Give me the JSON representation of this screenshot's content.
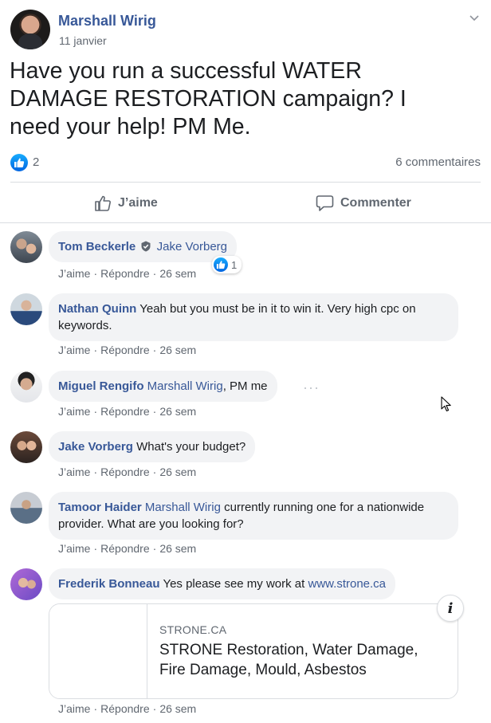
{
  "post": {
    "author": "Marshall Wirig",
    "date": "11 janvier",
    "text": "Have you run a successful WATER DAMAGE RESTORATION campaign? I need your help! PM Me.",
    "reaction_count": "2",
    "comments_count": "6 commentaires",
    "like_label": "J’aime",
    "comment_label": "Commenter"
  },
  "actions": {
    "like": "J’aime",
    "reply": "Répondre",
    "sep": "·"
  },
  "comments": [
    {
      "name": "Tom Beckerle",
      "verified": true,
      "mention": "Jake Vorberg",
      "text": "",
      "time": "26 sem",
      "reactions": "1"
    },
    {
      "name": "Nathan Quinn",
      "mention": "",
      "text": "Yeah but you must be in it to win it. Very high cpc on keywords.",
      "time": "26 sem"
    },
    {
      "name": "Miguel Rengifo",
      "mention": "Marshall Wirig",
      "text": ", PM me",
      "time": "26 sem",
      "more": "···"
    },
    {
      "name": "Jake Vorberg",
      "mention": "",
      "text": "What's your budget?",
      "time": "26 sem"
    },
    {
      "name": "Tamoor Haider",
      "mention": "Marshall Wirig",
      "text": "currently running one for a nationwide provider. What are you looking for?",
      "time": "26 sem"
    },
    {
      "name": "Frederik Bonneau",
      "mention": "",
      "text": "Yes please see my work at",
      "link": "www.strone.ca",
      "time": "26 sem"
    }
  ],
  "link_preview": {
    "domain": "STRONE.CA",
    "title": "STRONE Restoration, Water Damage, Fire Damage, Mould, Asbestos",
    "info_icon": "i"
  },
  "colors": {
    "link": "#385898",
    "muted": "#606770",
    "bubble": "#f2f3f5",
    "like_blue": "#1877f2"
  }
}
